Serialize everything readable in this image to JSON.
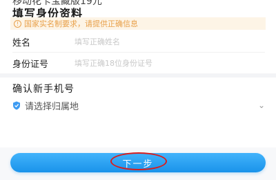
{
  "header": {
    "plan_name_clipped": "移动花卡宝藏版19元",
    "section_title": "填写身份资料"
  },
  "notice": {
    "text": "国家实名制要求，请提供正确信息",
    "icon": "info-circle-icon",
    "color": "#e8a04a"
  },
  "form": {
    "name_label": "姓名",
    "name_placeholder": "填写正确姓名",
    "name_value": "",
    "id_label": "身份证号",
    "id_placeholder": "填写正确18位身份证号",
    "id_value": ""
  },
  "phone_section": {
    "title": "确认新手机号",
    "region_placeholder": "请选择归属地",
    "location_icon": "location-shield-icon",
    "chevron_icon": "chevron-down-icon"
  },
  "footer": {
    "next_label": "下一步",
    "accent": "#1a93ea",
    "annotation_color": "#d81e1e"
  }
}
